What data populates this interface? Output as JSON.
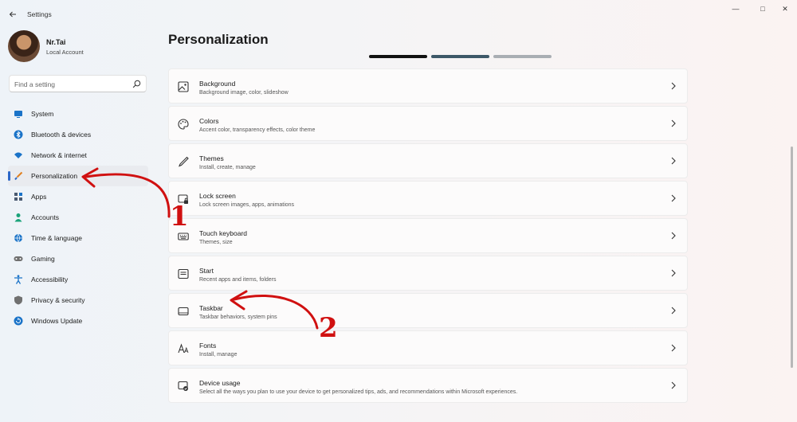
{
  "window": {
    "title": "Settings",
    "minimize": "—",
    "maximize": "□",
    "close": "✕"
  },
  "profile": {
    "name": "Nr.Tai",
    "account_type": "Local Account"
  },
  "search": {
    "placeholder": "Find a setting",
    "icon": "search-icon"
  },
  "sidebar": {
    "items": [
      {
        "label": "System",
        "icon": "monitor-icon",
        "color": "#1a73c8"
      },
      {
        "label": "Bluetooth & devices",
        "icon": "bluetooth-icon",
        "color": "#1a73c8"
      },
      {
        "label": "Network & internet",
        "icon": "wifi-icon",
        "color": "#1a73c8"
      },
      {
        "label": "Personalization",
        "icon": "brush-icon",
        "color": "#e08020",
        "active": true
      },
      {
        "label": "Apps",
        "icon": "apps-icon",
        "color": "#4a5a70"
      },
      {
        "label": "Accounts",
        "icon": "person-icon",
        "color": "#1aa37a"
      },
      {
        "label": "Time & language",
        "icon": "globe-icon",
        "color": "#1a73c8"
      },
      {
        "label": "Gaming",
        "icon": "gamepad-icon",
        "color": "#707070"
      },
      {
        "label": "Accessibility",
        "icon": "accessibility-icon",
        "color": "#1a73c8"
      },
      {
        "label": "Privacy & security",
        "icon": "shield-icon",
        "color": "#707070"
      },
      {
        "label": "Windows Update",
        "icon": "update-icon",
        "color": "#1a73c8"
      }
    ]
  },
  "main": {
    "title": "Personalization",
    "cards": [
      {
        "title": "Background",
        "desc": "Background image, color, slideshow",
        "icon": "image-icon"
      },
      {
        "title": "Colors",
        "desc": "Accent color, transparency effects, color theme",
        "icon": "palette-icon"
      },
      {
        "title": "Themes",
        "desc": "Install, create, manage",
        "icon": "pen-icon"
      },
      {
        "title": "Lock screen",
        "desc": "Lock screen images, apps, animations",
        "icon": "lock-screen-icon"
      },
      {
        "title": "Touch keyboard",
        "desc": "Themes, size",
        "icon": "keyboard-icon"
      },
      {
        "title": "Start",
        "desc": "Recent apps and items, folders",
        "icon": "start-icon"
      },
      {
        "title": "Taskbar",
        "desc": "Taskbar behaviors, system pins",
        "icon": "taskbar-icon"
      },
      {
        "title": "Fonts",
        "desc": "Install, manage",
        "icon": "fonts-icon"
      },
      {
        "title": "Device usage",
        "desc": "Select all the ways you plan to use your device to get personalized tips, ads, and recommendations within Microsoft experiences.",
        "icon": "device-usage-icon"
      }
    ]
  },
  "annotations": {
    "step1": "1",
    "step2": "2",
    "color": "#d01010"
  }
}
